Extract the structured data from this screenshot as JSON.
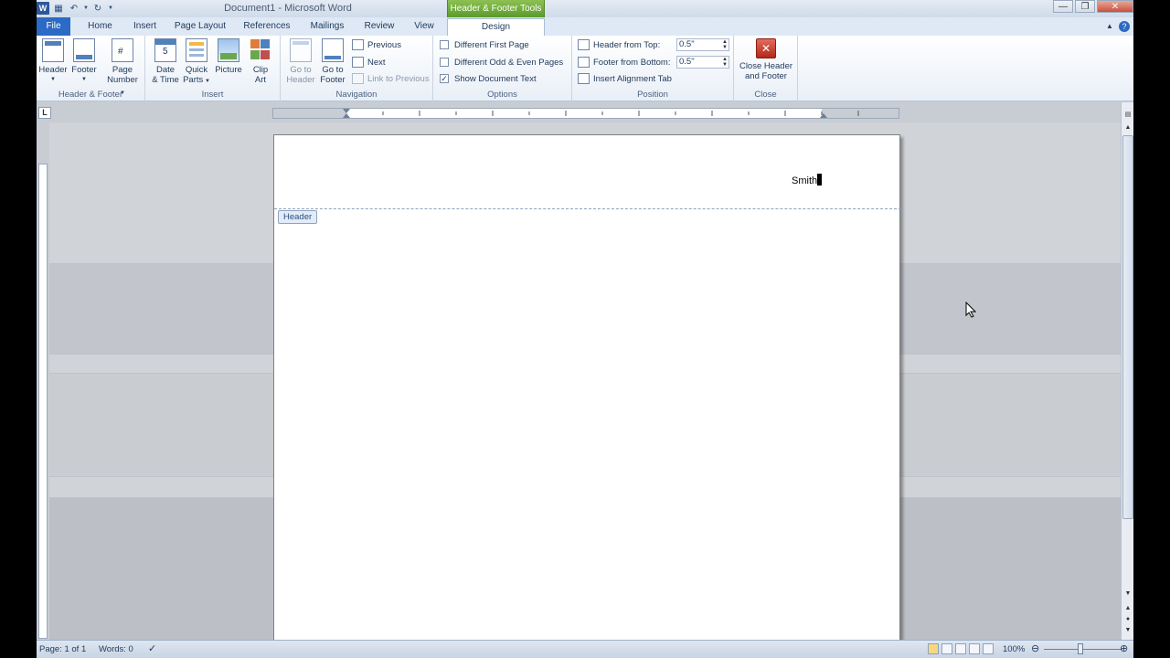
{
  "titlebar": {
    "title": "Document1 - Microsoft Word",
    "context_tab_header": "Header & Footer Tools"
  },
  "tabs": {
    "file": "File",
    "home": "Home",
    "insert": "Insert",
    "page_layout": "Page Layout",
    "references": "References",
    "mailings": "Mailings",
    "review": "Review",
    "view": "View",
    "design": "Design"
  },
  "ribbon": {
    "header_footer": {
      "header": "Header",
      "footer": "Footer",
      "page_number_1": "Page",
      "page_number_2": "Number",
      "label": "Header & Footer"
    },
    "insert": {
      "date_1": "Date",
      "date_2": "& Time",
      "quick_1": "Quick",
      "quick_2": "Parts",
      "picture": "Picture",
      "clip_1": "Clip",
      "clip_2": "Art",
      "label": "Insert"
    },
    "navigation": {
      "goto_header_1": "Go to",
      "goto_header_2": "Header",
      "goto_footer_1": "Go to",
      "goto_footer_2": "Footer",
      "previous": "Previous",
      "next": "Next",
      "link_previous": "Link to Previous",
      "label": "Navigation"
    },
    "options": {
      "diff_first": "Different First Page",
      "diff_odd_even": "Different Odd & Even Pages",
      "show_doc_text": "Show Document Text",
      "label": "Options"
    },
    "position": {
      "header_from_top": "Header from Top:",
      "header_from_top_value": "0.5\"",
      "footer_from_bottom": "Footer from Bottom:",
      "footer_from_bottom_value": "0.5\"",
      "insert_alignment_tab": "Insert Alignment Tab",
      "label": "Position"
    },
    "close": {
      "close_1": "Close Header",
      "close_2": "and Footer",
      "label": "Close"
    }
  },
  "document": {
    "header_text": "Smith",
    "header_tag": "Header"
  },
  "status": {
    "page": "Page: 1 of 1",
    "words": "Words: 0",
    "zoom": "100%"
  },
  "colors": {
    "file_tab": "#2b6ac5",
    "context_green": "#6aab34",
    "close_red": "#c0392b"
  }
}
